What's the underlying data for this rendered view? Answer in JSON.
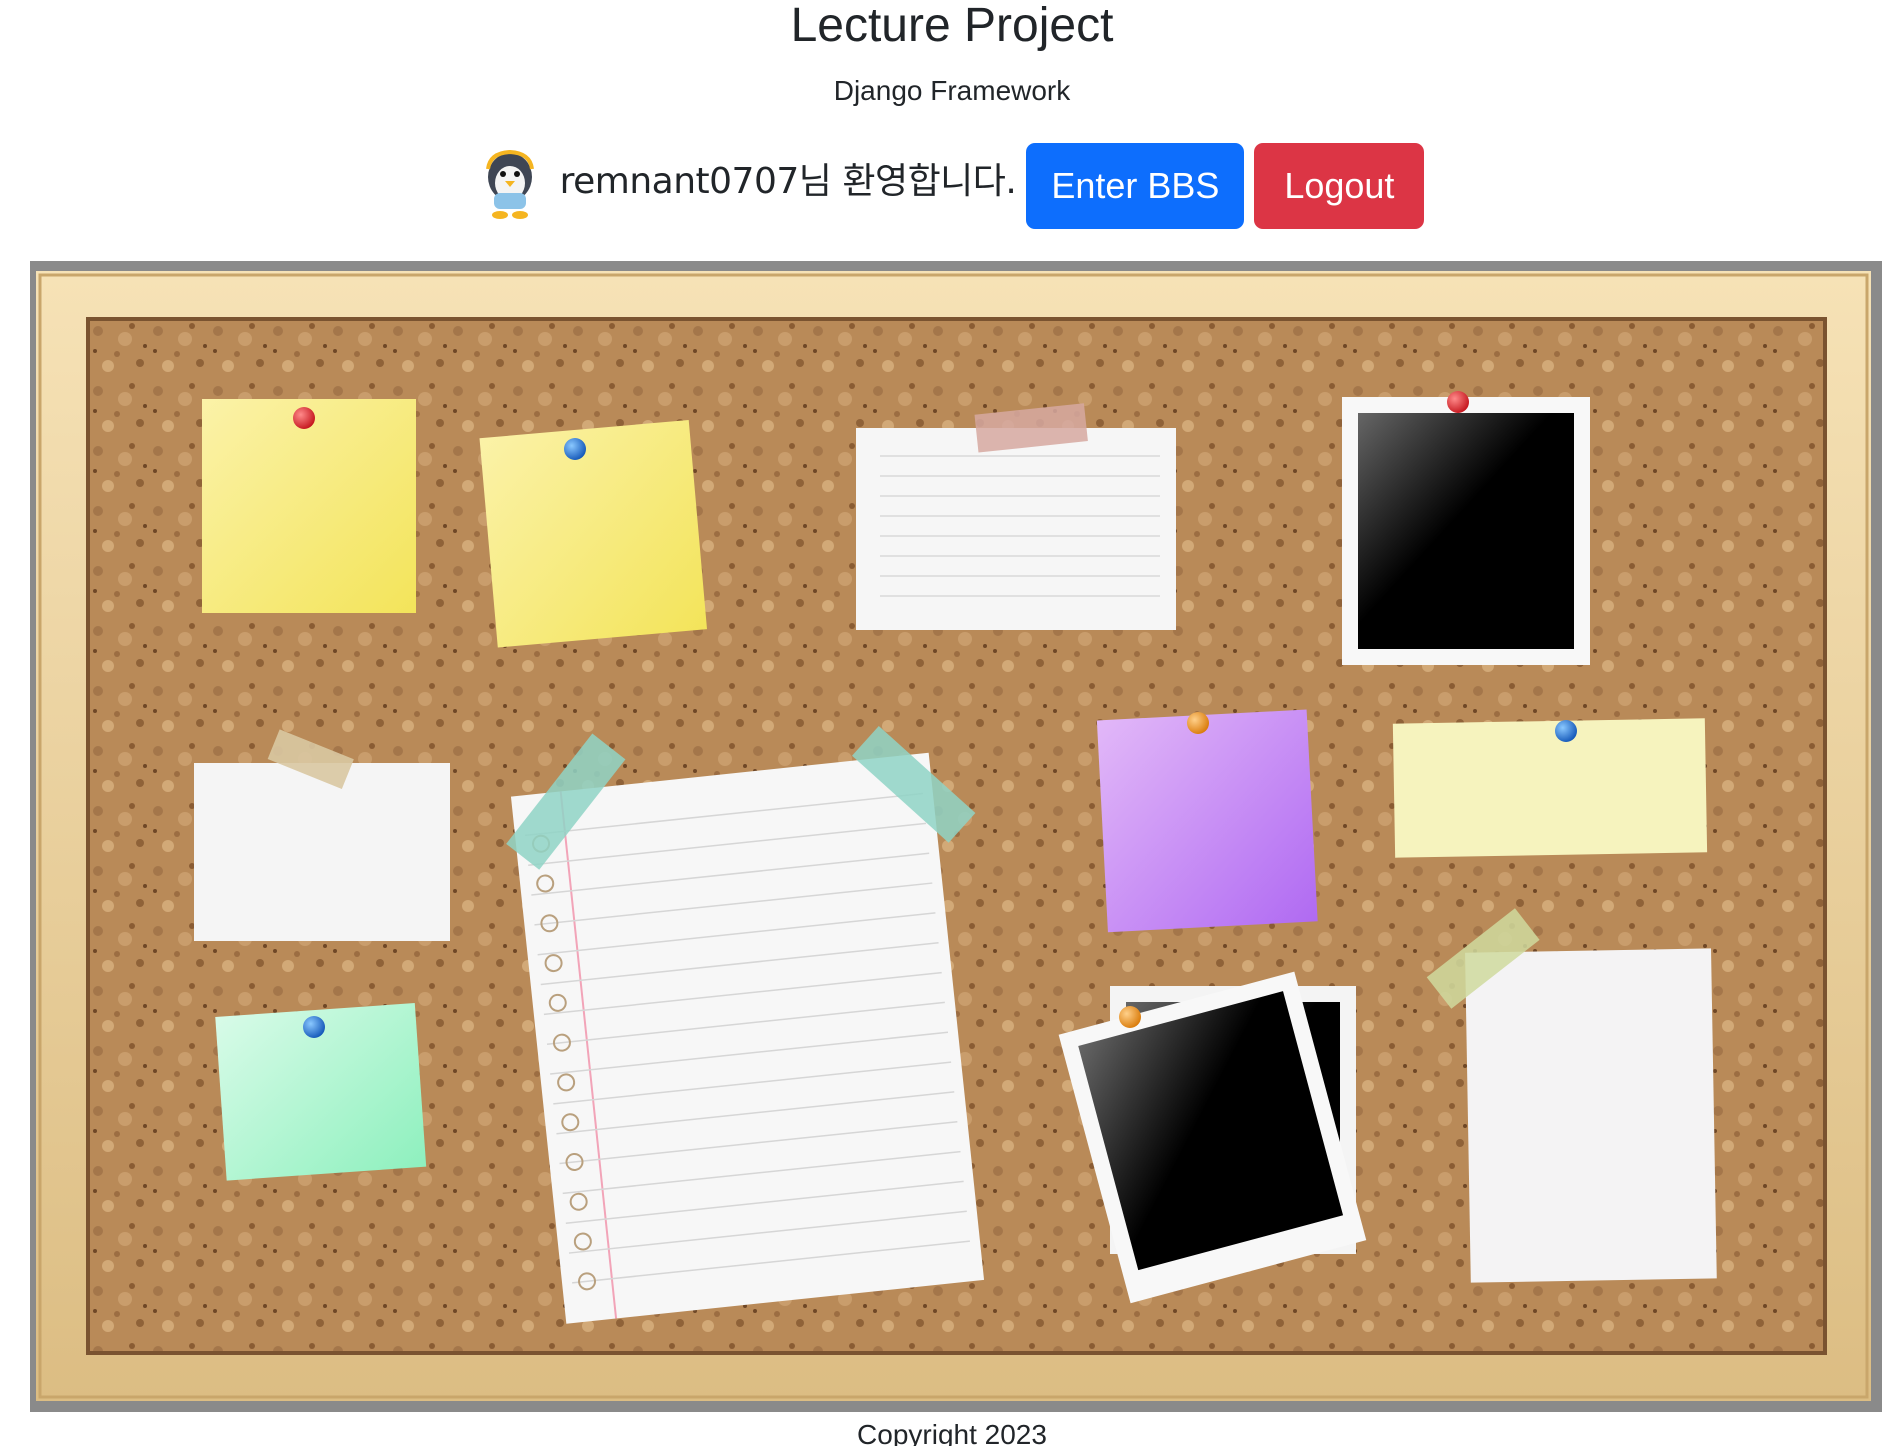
{
  "header": {
    "title": "Lecture Project",
    "subtitle": "Django Framework"
  },
  "user": {
    "avatar_icon": "penguin-avatar-icon",
    "welcome_text": "remnant0707님 환영합니다."
  },
  "actions": {
    "enter_bbs_label": "Enter BBS",
    "logout_label": "Logout"
  },
  "colors": {
    "primary": "#0d6efd",
    "danger": "#dc3545",
    "cork": "#b8895a",
    "frame": "#f0d9a8"
  },
  "footer": {
    "copyright": "Copyright 2023"
  }
}
